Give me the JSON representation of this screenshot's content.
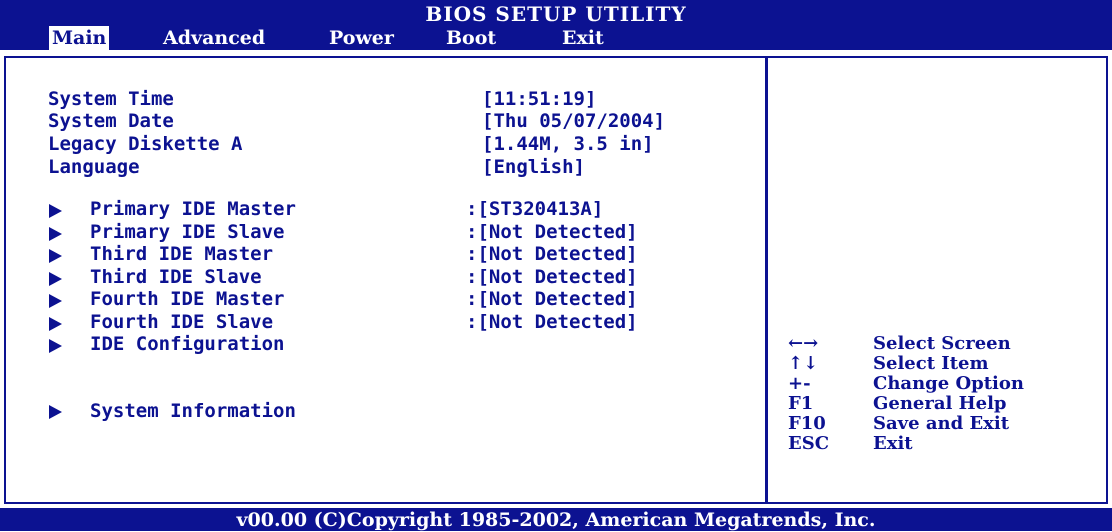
{
  "header": {
    "title": "BIOS SETUP UTILITY",
    "tabs": [
      {
        "label": "Main"
      },
      {
        "label": "Advanced"
      },
      {
        "label": "Power"
      },
      {
        "label": "Boot"
      },
      {
        "label": "Exit"
      }
    ],
    "active_tab": "Main"
  },
  "main": {
    "settings": [
      {
        "label": "System Time",
        "value": "[11:51:19]"
      },
      {
        "label": "System Date",
        "value": "[Thu 05/07/2004]"
      },
      {
        "label": "Legacy Diskette A",
        "value": "[1.44M, 3.5 in]"
      },
      {
        "label": "Language",
        "value": "[English]"
      }
    ],
    "submenus": [
      {
        "label": "Primary IDE Master",
        "value": ":[ST320413A]"
      },
      {
        "label": "Primary IDE Slave",
        "value": ":[Not Detected]"
      },
      {
        "label": "Third IDE Master",
        "value": ":[Not Detected]"
      },
      {
        "label": "Third IDE Slave",
        "value": ":[Not Detected]"
      },
      {
        "label": "Fourth IDE Master",
        "value": ":[Not Detected]"
      },
      {
        "label": "Fourth IDE Slave",
        "value": ":[Not Detected]"
      },
      {
        "label": "IDE Configuration",
        "value": ""
      },
      {
        "label": "System Information",
        "value": ""
      }
    ]
  },
  "help_panel": {
    "keys": [
      {
        "key": "←→",
        "action": "Select Screen"
      },
      {
        "key": "↑↓",
        "action": "Select Item"
      },
      {
        "key": "+-",
        "action": "Change Option"
      },
      {
        "key": "F1",
        "action": "General Help"
      },
      {
        "key": "F10",
        "action": "Save and Exit"
      },
      {
        "key": "ESC",
        "action": "Exit"
      }
    ]
  },
  "footer": {
    "text": "v00.00 (C)Copyright 1985-2002, American Megatrends, Inc."
  },
  "colors": {
    "bios_blue": "#0c1291",
    "background": "#ffffff"
  }
}
